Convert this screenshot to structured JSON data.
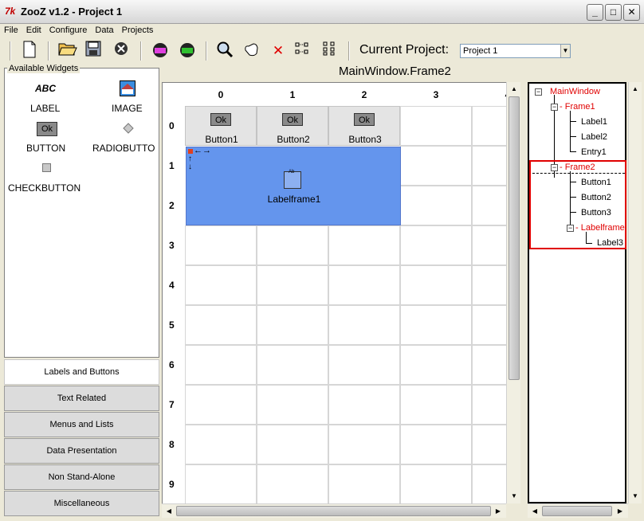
{
  "window": {
    "icon_text": "7k",
    "title": "ZooZ v1.2 - Project 1",
    "minimize_glyph": "_",
    "maximize_glyph": "□",
    "close_glyph": "✕"
  },
  "menu": [
    "File",
    "Edit",
    "Configure",
    "Data",
    "Projects"
  ],
  "toolbar": {
    "current_project_label": "Current Project:",
    "project_selected": "Project 1"
  },
  "widgets_panel": {
    "title": "Available Widgets",
    "items": [
      {
        "name": "LABEL",
        "icon_text": "ABC"
      },
      {
        "name": "IMAGE"
      },
      {
        "name": "BUTTON",
        "icon_text": "Ok"
      },
      {
        "name": "RADIOBUTTO"
      },
      {
        "name": "CHECKBUTTON"
      }
    ],
    "categories": [
      {
        "label": "Labels and Buttons",
        "active": true
      },
      {
        "label": "Text Related"
      },
      {
        "label": "Menus and Lists"
      },
      {
        "label": "Data Presentation"
      },
      {
        "label": "Non Stand-Alone"
      },
      {
        "label": "Miscellaneous"
      }
    ]
  },
  "editor": {
    "frame_title": "MainWindow.Frame2",
    "columns": [
      "0",
      "1",
      "2",
      "3"
    ],
    "rows": [
      "0",
      "1",
      "2",
      "3",
      "4",
      "5",
      "6",
      "7",
      "8",
      "9"
    ],
    "buttons": [
      {
        "name": "Button1",
        "text": "Ok"
      },
      {
        "name": "Button2",
        "text": "Ok"
      },
      {
        "name": "Button3",
        "text": "Ok"
      }
    ],
    "labelframe": {
      "name": "Labelframe1",
      "box_text": "Ab"
    }
  },
  "tree": {
    "nodes": [
      {
        "label": "MainWindow",
        "red": true
      },
      {
        "label": "Frame1",
        "red": true
      },
      {
        "label": "Label1"
      },
      {
        "label": "Label2"
      },
      {
        "label": "Entry1"
      },
      {
        "label": "Frame2",
        "red": true
      },
      {
        "label": "Button1"
      },
      {
        "label": "Button2"
      },
      {
        "label": "Button3"
      },
      {
        "label": "Labelframe",
        "red": true
      },
      {
        "label": "Label3"
      }
    ]
  },
  "colors": {
    "labelframe_bg": "#6495ed",
    "tree_selected": "#e00000"
  }
}
